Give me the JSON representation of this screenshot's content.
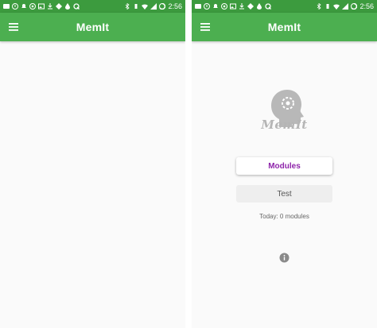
{
  "status_bar": {
    "time": "2:56"
  },
  "app_bar": {
    "title": "MemIt"
  },
  "main": {
    "logo_text": "MemIt",
    "modules_label": "Modules",
    "test_label": "Test",
    "today_text": "Today: 0 modules"
  },
  "colors": {
    "status_bar": "#3c9b3e",
    "app_bar": "#4caf50",
    "accent": "#8e24aa",
    "background": "#fafafa"
  }
}
